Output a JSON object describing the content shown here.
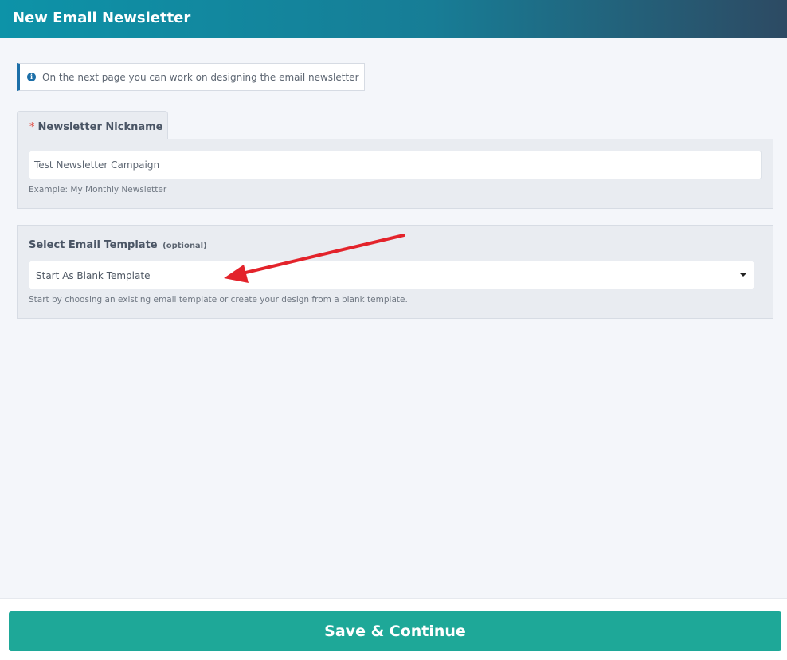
{
  "header": {
    "title": "New Email Newsletter"
  },
  "info_banner": {
    "text": "On the next page you can work on designing the email newsletter",
    "icon": "info-icon"
  },
  "nickname": {
    "required_marker": "*",
    "label": "Newsletter Nickname",
    "value": "Test Newsletter Campaign",
    "hint": "Example: My Monthly Newsletter"
  },
  "template": {
    "label": "Select Email Template",
    "optional": "(optional)",
    "selected": "Start As Blank Template",
    "hint": "Start by choosing an existing email template or create your design from a blank template."
  },
  "footer": {
    "save_label": "Save & Continue"
  },
  "colors": {
    "header_start": "#0d93a8",
    "header_end": "#2d4a63",
    "button": "#1ea898",
    "arrow": "#e3232b",
    "required": "#e0463e"
  }
}
